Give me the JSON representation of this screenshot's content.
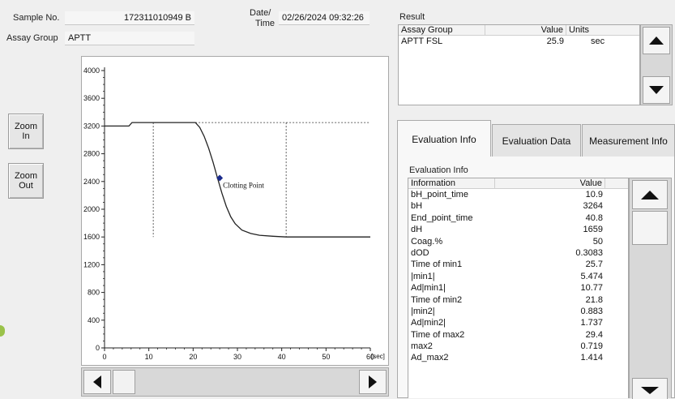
{
  "header": {
    "sample_no_label": "Sample No.",
    "sample_no_value": "172311010949  B",
    "assay_group_label": "Assay Group",
    "assay_group_value": "APTT",
    "datetime_label_1": "Date/",
    "datetime_label_2": "Time",
    "datetime_value": "02/26/2024 09:32:26"
  },
  "zoom": {
    "zoom_in_line1": "Zoom",
    "zoom_in_line2": "In",
    "zoom_out_line1": "Zoom",
    "zoom_out_line2": "Out"
  },
  "chart_data": {
    "type": "line",
    "title": "",
    "xlabel": "[sec]",
    "ylabel": "",
    "xlim": [
      0,
      60
    ],
    "ylim": [
      0,
      4000
    ],
    "xticks": [
      0,
      10,
      20,
      30,
      40,
      50,
      60
    ],
    "yticks": [
      0,
      400,
      800,
      1200,
      1600,
      2000,
      2400,
      2800,
      3200,
      3600,
      4000
    ],
    "series": [
      {
        "x": [
          0,
          3,
          5.5,
          6.2,
          7,
          10,
          15,
          20.5,
          21.5,
          22.5,
          23.5,
          24.5,
          25.5,
          26.5,
          27.5,
          28.5,
          29.5,
          31,
          33,
          35,
          38,
          41,
          45,
          50,
          55,
          60
        ],
        "y": [
          3200,
          3200,
          3200,
          3250,
          3250,
          3250,
          3250,
          3250,
          3180,
          3050,
          2880,
          2680,
          2450,
          2230,
          2040,
          1890,
          1790,
          1700,
          1650,
          1625,
          1610,
          1600,
          1600,
          1600,
          1600,
          1600
        ]
      }
    ],
    "reference_line_y": 3250,
    "vertical_markers_x": [
      11,
      41
    ],
    "vertical_marker_y_bottom": 1600,
    "point": {
      "x": 26,
      "y": 2450,
      "label": "Clotting Point"
    }
  },
  "result": {
    "title": "Result",
    "columns": [
      "Assay Group",
      "Value",
      "Units"
    ],
    "rows": [
      {
        "assay": "APTT FSL",
        "value": "25.9",
        "units": "sec"
      }
    ]
  },
  "tabs": [
    {
      "label": "Evaluation Info",
      "active": true
    },
    {
      "label": "Evaluation Data",
      "active": false
    },
    {
      "label": "Measurement Info",
      "active": false
    }
  ],
  "eval": {
    "group_label": "Evaluation Info",
    "columns": [
      "Information",
      "Value"
    ],
    "rows": [
      {
        "info": "bH_point_time",
        "value": "10.9"
      },
      {
        "info": "bH",
        "value": "3264"
      },
      {
        "info": "End_point_time",
        "value": "40.8"
      },
      {
        "info": "dH",
        "value": "1659"
      },
      {
        "info": "Coag.%",
        "value": "50"
      },
      {
        "info": "dOD",
        "value": "0.3083"
      },
      {
        "info": "Time of min1",
        "value": "25.7"
      },
      {
        "info": "|min1|",
        "value": "5.474"
      },
      {
        "info": "Ad|min1|",
        "value": "10.77"
      },
      {
        "info": "Time of min2",
        "value": "21.8"
      },
      {
        "info": "|min2|",
        "value": "0.883"
      },
      {
        "info": "Ad|min2|",
        "value": "1.737"
      },
      {
        "info": "Time of max2",
        "value": "29.4"
      },
      {
        "info": "max2",
        "value": "0.719"
      },
      {
        "info": "Ad_max2",
        "value": "1.414"
      }
    ]
  },
  "colors": {
    "curve": "#222222",
    "clotting_point": "#1a2a8c"
  }
}
